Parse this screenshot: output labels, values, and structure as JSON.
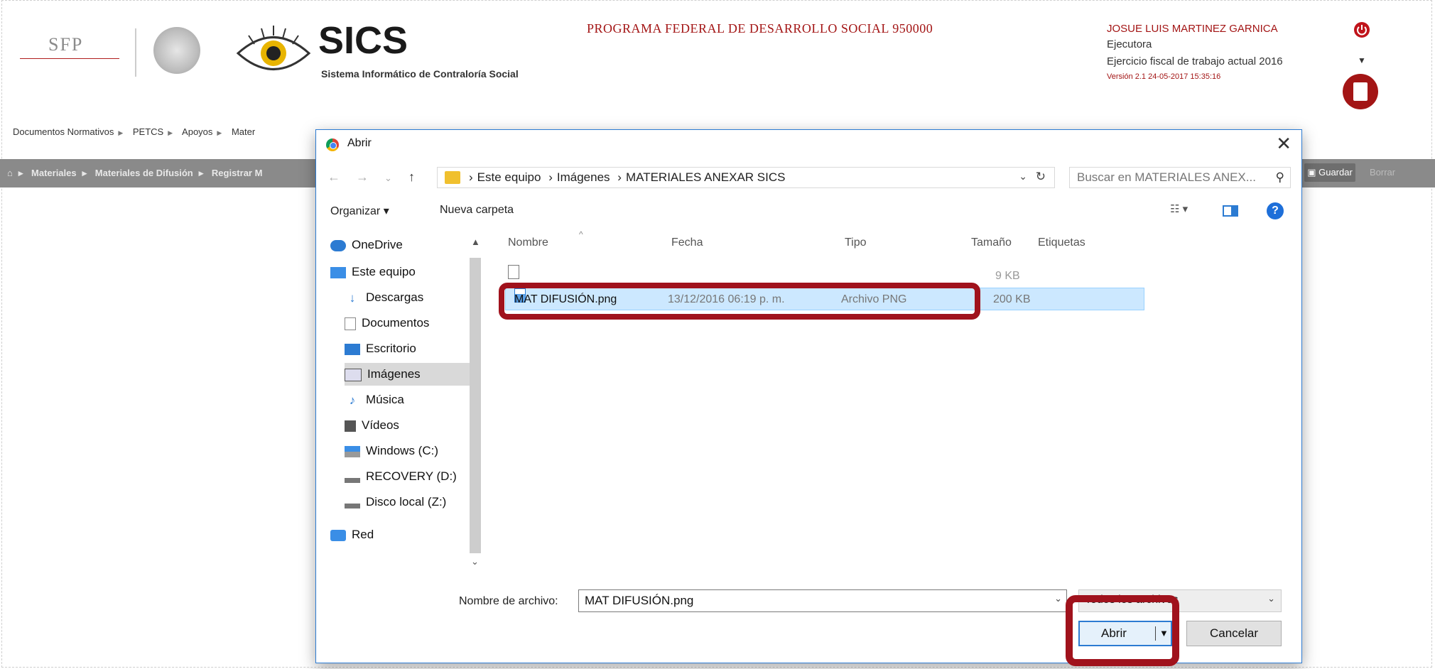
{
  "header": {
    "logo_sfp": "SFP",
    "app_name": "SICS",
    "app_subtitle": "Sistema Informático de Contraloría Social",
    "program": "PROGRAMA FEDERAL DE DESARROLLO SOCIAL 950000",
    "user_name": "JOSUE LUIS MARTINEZ GARNICA",
    "user_role": "Ejecutora",
    "fiscal_year": "Ejercicio fiscal de trabajo actual  2016",
    "version": "Versión 2.1    24-05-2017 15:35:16"
  },
  "nav": {
    "items": [
      "Documentos Normativos",
      "PETCS",
      "Apoyos",
      "Mater"
    ]
  },
  "breadcrumb": {
    "items": [
      "Materiales",
      "Materiales de Difusión",
      "Registrar M"
    ],
    "save_label": "Guardar",
    "delete_label": "Borrar"
  },
  "dialog": {
    "title": "Abrir",
    "path": [
      "Este equipo",
      "Imágenes",
      "MATERIALES ANEXAR SICS"
    ],
    "search_placeholder": "Buscar en MATERIALES ANEX...",
    "organize_label": "Organizar ▾",
    "new_folder_label": "Nueva carpeta",
    "sidebar": [
      "OneDrive",
      "Este equipo",
      "Descargas",
      "Documentos",
      "Escritorio",
      "Imágenes",
      "Música",
      "Vídeos",
      "Windows (C:)",
      "RECOVERY (D:)",
      "Disco local (Z:)",
      "Red"
    ],
    "columns": [
      "Nombre",
      "Fecha",
      "Tipo",
      "Tamaño",
      "Etiquetas"
    ],
    "files": [
      {
        "name": "",
        "date": "",
        "type": "",
        "size": "9 KB"
      },
      {
        "name": "MAT DIFUSIÓN.png",
        "date": "13/12/2016 06:19 p. m.",
        "type": "Archivo PNG",
        "size": "200 KB"
      }
    ],
    "filename_label": "Nombre de archivo:",
    "filename_value": "MAT DIFUSIÓN.png",
    "filetype_value": "Todos los archivos",
    "open_label": "Abrir",
    "cancel_label": "Cancelar"
  }
}
